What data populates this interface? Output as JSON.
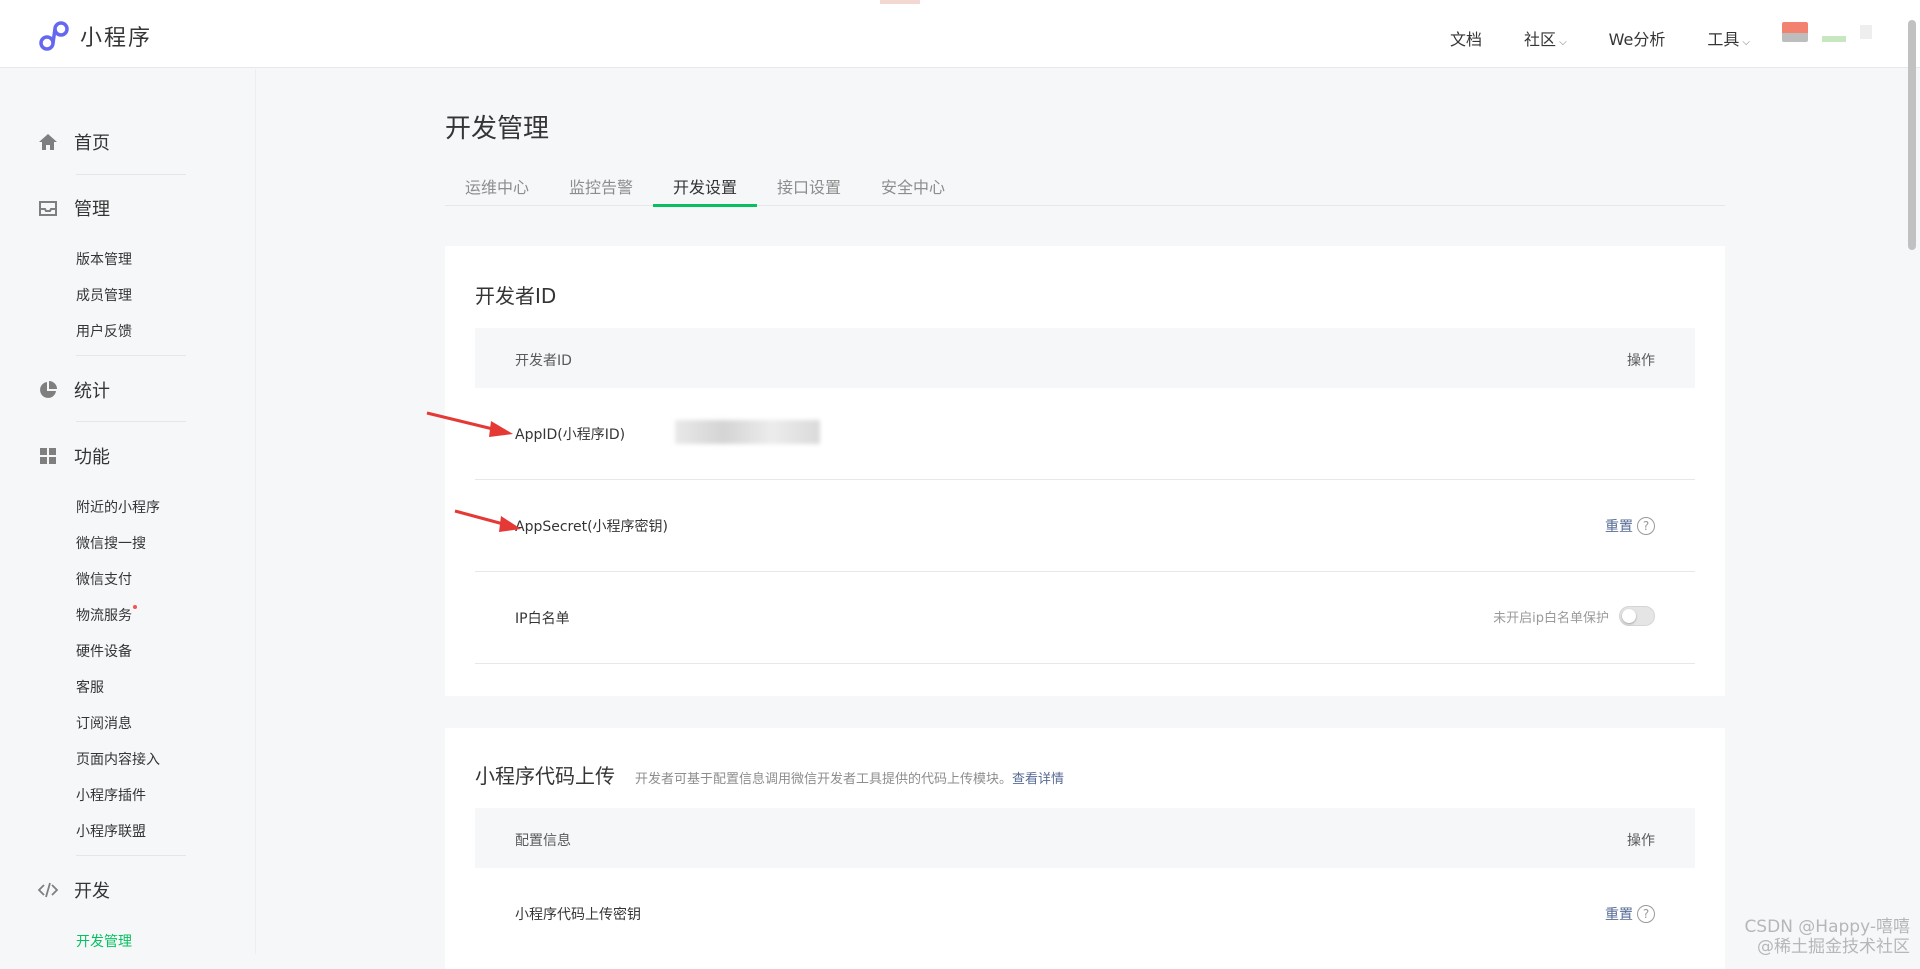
{
  "topbar": {
    "logo_text": "小程序",
    "nav": [
      {
        "label": "文档",
        "has_caret": false
      },
      {
        "label": "社区",
        "has_caret": true
      },
      {
        "label": "We分析",
        "has_caret": false
      },
      {
        "label": "工具",
        "has_caret": true
      }
    ]
  },
  "sidebar": {
    "home": "首页",
    "manage": "管理",
    "manage_items": [
      "版本管理",
      "成员管理",
      "用户反馈"
    ],
    "stats": "统计",
    "features": "功能",
    "feature_items": [
      "附近的小程序",
      "微信搜一搜",
      "微信支付",
      "物流服务",
      "硬件设备",
      "客服",
      "订阅消息",
      "页面内容接入",
      "小程序插件",
      "小程序联盟"
    ],
    "dev": "开发",
    "dev_items": [
      "开发管理"
    ]
  },
  "main": {
    "title": "开发管理",
    "tabs": [
      "运维中心",
      "监控告警",
      "开发设置",
      "接口设置",
      "安全中心"
    ],
    "active_tab": 2,
    "developer_id": {
      "title": "开发者ID",
      "header_left": "开发者ID",
      "header_right": "操作",
      "rows": [
        {
          "label": "AppID(小程序ID)"
        },
        {
          "label": "AppSecret(小程序密钥)",
          "action": "重置"
        },
        {
          "label": "IP白名单",
          "status": "未开启ip白名单保护"
        }
      ]
    },
    "upload": {
      "title": "小程序代码上传",
      "desc": "开发者可基于配置信息调用微信开发者工具提供的代码上传模块。",
      "desc_link": "查看详情",
      "header_left": "配置信息",
      "header_right": "操作",
      "rows": [
        {
          "label": "小程序代码上传密钥",
          "action": "重置"
        }
      ]
    }
  },
  "watermark": {
    "line1": "CSDN @Happy-嘻嘻",
    "line2": "@稀土掘金技术社区"
  },
  "colors": {
    "accent": "#07c160",
    "link": "#576b95",
    "arrow": "#e53935"
  }
}
